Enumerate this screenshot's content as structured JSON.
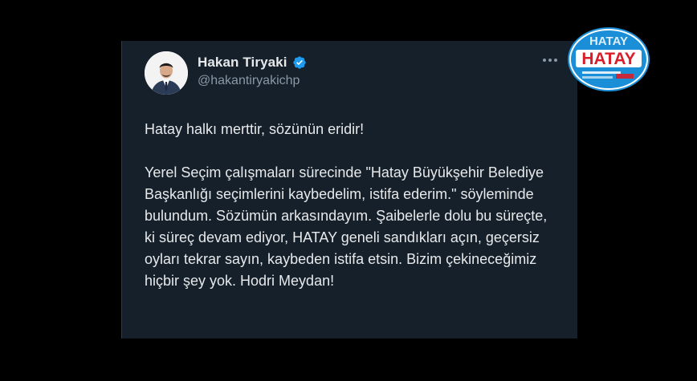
{
  "tweet": {
    "author_name": "Hakan Tiryaki",
    "author_handle": "@hakantiryakichp",
    "verified": true,
    "paragraphs": [
      "Hatay halkı merttir, sözünün eridir!",
      "Yerel Seçim çalışmaları sürecinde \"Hatay Büyükşehir Belediye Başkanlığı seçimlerini kaybedelim, istifa ederim.\" söyleminde bulundum. Sözümün arkasındayım. Şaibelerle dolu bu süreçte, ki süreç devam ediyor, HATAY geneli sandıkları açın, geçersiz oyları tekrar sayın, kaybeden istifa etsin. Bizim çekineceğimiz hiçbir şey yok. Hodri Meydan!"
    ]
  },
  "logo": {
    "text": "HATAY"
  },
  "colors": {
    "background": "#000000",
    "card": "#15202b",
    "text_primary": "#e7e9ea",
    "text_secondary": "#8b98a5",
    "verified_blue": "#1d9bf0",
    "logo_blue": "#1a8fd8",
    "logo_red": "#d81e2a"
  },
  "icons": {
    "avatar": "person-avatar",
    "verified": "verified-badge-icon",
    "more": "more-options-icon"
  }
}
